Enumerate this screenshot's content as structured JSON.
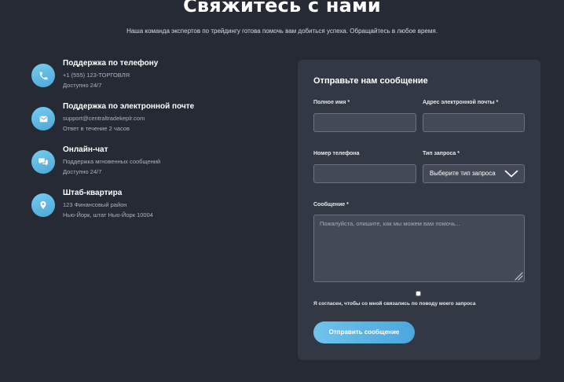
{
  "page": {
    "title": "Свяжитесь с нами",
    "subtitle": "Наша команда экспертов по трейдингу готова помочь вам добиться успеха. Обращайтесь в любое время."
  },
  "contacts": [
    {
      "icon": "phone-icon",
      "title": "Поддержка по телефону",
      "line1": "+1 (555) 123-ТОРГОВЛЯ",
      "line2": "Доступно 24/7"
    },
    {
      "icon": "envelope-icon",
      "title": "Поддержка по электронной почте",
      "line1": "support@centraltradekeplr.com",
      "line2": "Ответ в течение 2 часов"
    },
    {
      "icon": "chat-bubbles-icon",
      "title": "Онлайн-чат",
      "line1": "Поддержка мгновенных сообщений",
      "line2": "Доступно 24/7"
    },
    {
      "icon": "location-pin-icon",
      "title": "Штаб-квартира",
      "line1": "123 Финансовый район",
      "line2": "Нью-Йорк, штат Нью-Йорк 10004"
    }
  ],
  "form": {
    "title": "Отправьте нам сообщение",
    "full_name": {
      "label": "Полное имя *",
      "value": "",
      "placeholder": ""
    },
    "email": {
      "label": "Адрес электронной почты *",
      "value": "",
      "placeholder": ""
    },
    "phone": {
      "label": "Номер телефона",
      "value": "",
      "placeholder": ""
    },
    "request_type": {
      "label": "Тип запроса *",
      "selected": "Выберите тип запроса"
    },
    "message": {
      "label": "Сообщение *",
      "value": "",
      "placeholder": "Пожалуйста, опишите, как мы можем вам помочь..."
    },
    "consent": {
      "label": "Я согласен, чтобы со мной связались по поводу моего запроса",
      "checked": false
    },
    "submit_label": "Отправить сообщение"
  },
  "colors": {
    "background": "#252a35",
    "card": "#323844",
    "accent": "#5bb5e4",
    "input_bg": "#434956",
    "input_border": "#6c7280"
  }
}
